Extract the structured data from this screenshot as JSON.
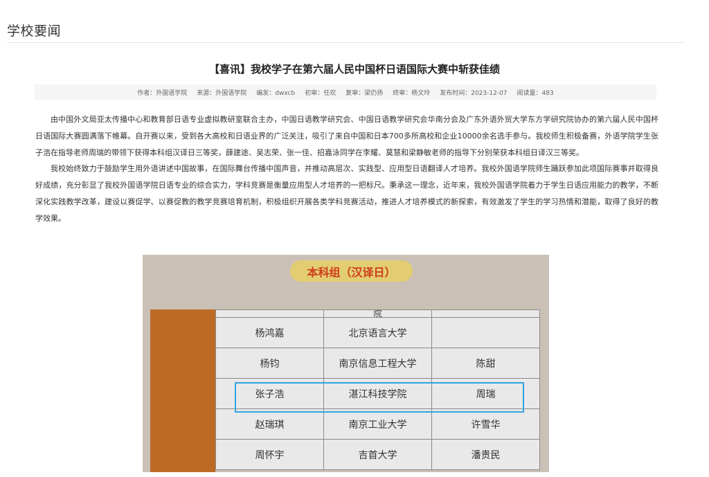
{
  "section": {
    "title": "学校要闻"
  },
  "article": {
    "title": "【喜讯】我校学子在第六届人民中国杯日语国际大赛中斩获佳绩",
    "meta": {
      "author": "作者：外国语学院",
      "source": "来源：外国语学院",
      "editor": "编发：dwxcb",
      "first_review": "初审：任欢",
      "second_review": "复审：梁仍扬",
      "final_review": "终审：杨文玲",
      "publish_time": "发布时间：2023-12-07",
      "views": "阅读量：483"
    },
    "paragraphs": [
      "由中国外文局亚太传播中心和教育部日语专业虚拟教研室联合主办，中国日语教学研究会、中国日语教学研究会华南分会及广东外语外贸大学东方学研究院协办的第六届人民中国杯日语国际大赛圆满落下帷幕。自开赛以来，受到各大高校和日语业界的广泛关注，吸引了来自中国和日本700多所高校和企业10000余名选手参与。我校师生积极备赛，外语学院学生张子浩在指导老师周瑞的带领下获得本科组汉译日三等奖，薛建途、吴志荣、张一佳、招嘉泳同学在李耀、莫慧和梁静敏老师的指导下分别荣获本科组日译汉三等奖。",
      "我校始终致力于鼓励学生用外语讲述中国故事，在国际舞台传播中国声音，并推动高层次、实践型、应用型日语翻译人才培养。我校外国语学院师生踊跃参加此项国际赛事并取得良好成绩，充分彰显了我校外国语学院日语专业的综合实力，学科竞赛是衡量应用型人才培养的一把标尺。秉承这一理念，近年来，我校外国语学院着力于学生日语应用能力的教学，不断深化实践教学改革，建设以赛促学、以赛促教的教学竞赛培育机制，积极组织开展各类学科竞赛活动，推进人才培养模式的新探索，有效激发了学生的学习热情和潜能，取得了良好的教学效果。"
    ]
  },
  "figure": {
    "title": "本科组（汉译日）",
    "partial_header": [
      "",
      "院",
      ""
    ],
    "rows": [
      [
        "杨鸿嘉",
        "北京语言大学",
        ""
      ],
      [
        "杨钧",
        "南京信息工程大学",
        "陈甜"
      ],
      [
        "张子浩",
        "湛江科技学院",
        "周瑞"
      ],
      [
        "赵瑞琪",
        "南京工业大学",
        "许雪华"
      ],
      [
        "周怀宇",
        "吉首大学",
        "潘贵民"
      ]
    ],
    "highlight_color": "#2fa3e0"
  }
}
